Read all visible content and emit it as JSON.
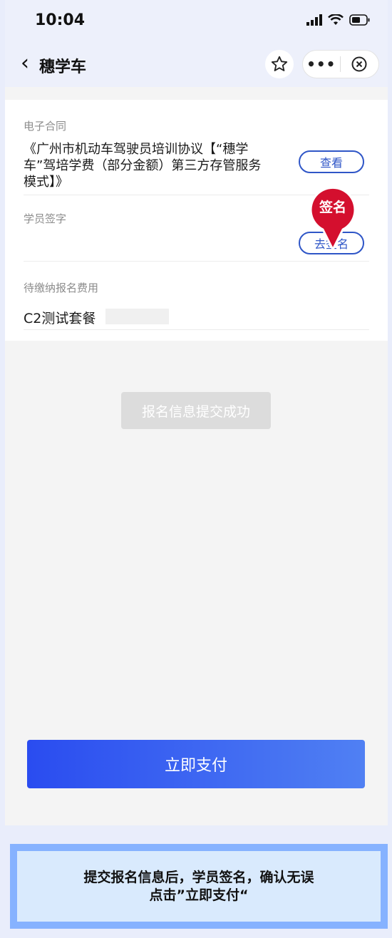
{
  "status_bar": {
    "time": "10:04"
  },
  "nav": {
    "title": "穗学车"
  },
  "contract": {
    "section_label": "电子合同",
    "title": "《广州市机动车驾驶员培训协议【“穗学车”驾培学费（部分金额）第三方存管服务模式】》",
    "view_button": "查看"
  },
  "signature": {
    "section_label": "学员签字",
    "sign_button": "去签名",
    "marker_label": "签名"
  },
  "fee": {
    "section_label": "待缴纳报名费用",
    "package": "C2测试套餐"
  },
  "success_button": "报名信息提交成功",
  "pay_button": "立即支付",
  "instruction": {
    "line1": "提交报名信息后，学员签名，确认无误",
    "line2": "点击”立即支付“"
  },
  "colors": {
    "accent": "#2f56c7",
    "marker": "#d40f2e",
    "pay_gradient_start": "#2a4cf0",
    "pay_gradient_end": "#5080f3"
  }
}
